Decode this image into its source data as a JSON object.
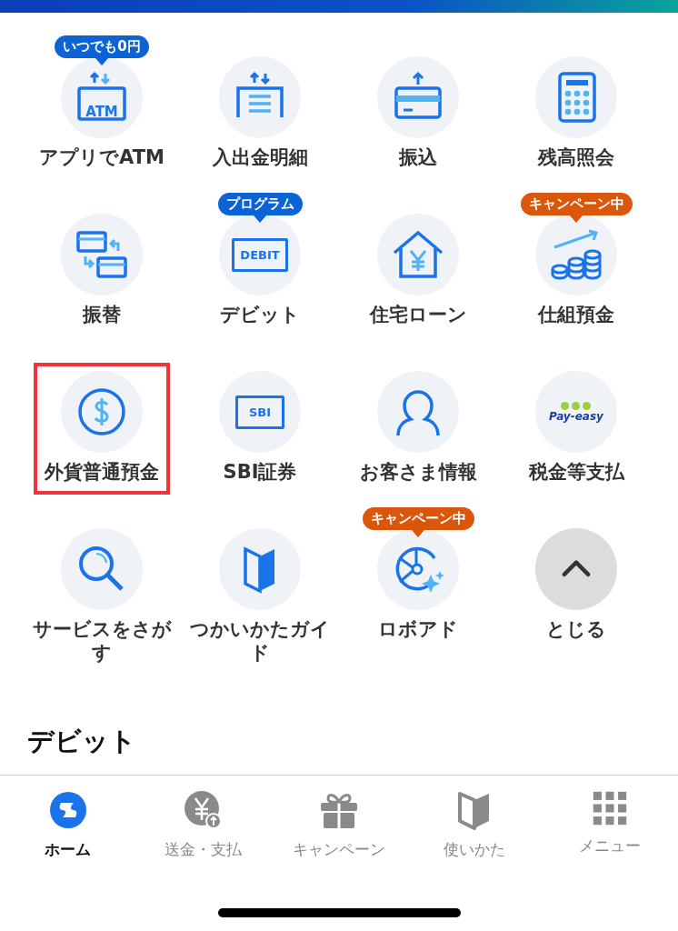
{
  "menu": [
    {
      "label": "アプリでATM",
      "icon_text": "ATM",
      "badge": {
        "text": "いつでも0円",
        "color": "#0b63d6"
      },
      "highlighted": false
    },
    {
      "label": "入出金明細",
      "highlighted": false
    },
    {
      "label": "振込",
      "highlighted": false
    },
    {
      "label": "残高照会",
      "highlighted": false
    },
    {
      "label": "振替",
      "highlighted": false
    },
    {
      "label": "デビット",
      "icon_text": "DEBIT",
      "badge": {
        "text": "プログラム",
        "color": "#0b63d6"
      },
      "highlighted": false
    },
    {
      "label": "住宅ローン",
      "highlighted": false
    },
    {
      "label": "仕組預金",
      "badge": {
        "text": "キャンペーン中",
        "color": "#d9560a"
      },
      "highlighted": false
    },
    {
      "label": "外貨普通預金",
      "highlighted": true
    },
    {
      "label": "SBI証券",
      "icon_text": "SBI",
      "highlighted": false
    },
    {
      "label": "お客さま情報",
      "highlighted": false
    },
    {
      "label": "税金等支払",
      "icon_text": "Pay-easy",
      "highlighted": false
    },
    {
      "label": "サービスをさがす",
      "highlighted": false
    },
    {
      "label": "つかいかたガイド",
      "highlighted": false
    },
    {
      "label": "ロボアド",
      "badge": {
        "text": "キャンペーン中",
        "color": "#d9560a"
      },
      "highlighted": false
    },
    {
      "label": "とじる",
      "highlighted": false
    }
  ],
  "section_title": "デビット",
  "tab_bar": [
    {
      "label": "ホーム",
      "selected": true
    },
    {
      "label": "送金・支払",
      "selected": false
    },
    {
      "label": "キャンペーン",
      "selected": false
    },
    {
      "label": "使いかた",
      "selected": false
    },
    {
      "label": "メニュー",
      "selected": false
    }
  ]
}
